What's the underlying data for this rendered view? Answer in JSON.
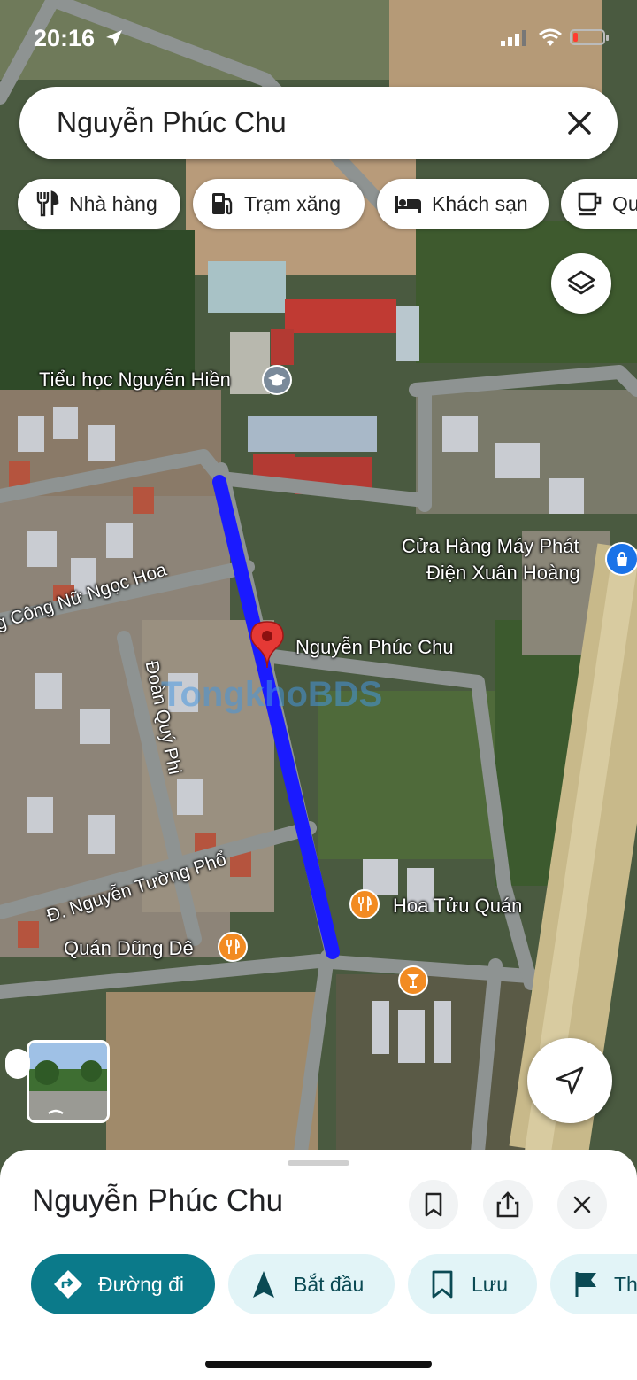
{
  "status": {
    "time": "20:16"
  },
  "search": {
    "query": "Nguyễn Phúc Chu"
  },
  "chips": [
    {
      "label": "Nhà hàng",
      "icon": "restaurant-icon"
    },
    {
      "label": "Trạm xăng",
      "icon": "gas-station-icon"
    },
    {
      "label": "Khách sạn",
      "icon": "hotel-icon"
    },
    {
      "label": "Qu",
      "icon": "coffee-icon"
    }
  ],
  "map_labels": {
    "school": "Tiểu học Nguyễn Hiền",
    "shop_line1": "Cửa Hàng Máy Phát",
    "shop_line2": "Điện Xuân Hoàng",
    "pin": "Nguyễn Phúc Chu",
    "street_cong_nu": "g Công Nữ Ngọc Hoa",
    "street_doan": "Đoàn Quý Phi",
    "street_nguyen_tuong": "Đ. Nguyễn Tường Phổ",
    "restaurant_hoa": "Hoa Tửu Quán",
    "restaurant_dung": "Quán Dũng Dê",
    "watermark": "TongkhoBDS"
  },
  "sheet": {
    "title": "Nguyễn Phúc Chu",
    "actions": [
      {
        "label": "Đường đi",
        "icon": "directions-icon"
      },
      {
        "label": "Bắt đầu",
        "icon": "navigation-arrow-icon"
      },
      {
        "label": "Lưu",
        "icon": "bookmark-icon"
      },
      {
        "label": "Th",
        "icon": "flag-icon"
      }
    ]
  },
  "colors": {
    "route": "#1a1aff",
    "teal": "#0b7a8a",
    "pin": "#e53935",
    "food_poi": "#f28b22",
    "chip_action_bg": "#e2f4f7"
  }
}
